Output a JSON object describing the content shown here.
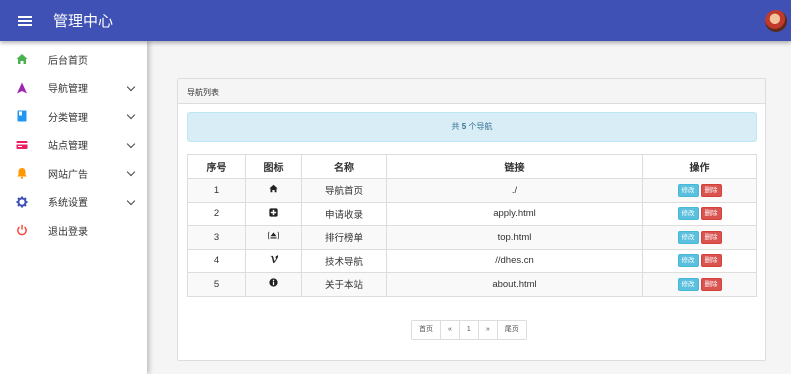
{
  "header": {
    "title": "管理中心"
  },
  "sidebar": {
    "items": [
      {
        "label": "后台首页",
        "icon": "home-icon",
        "color": "#4caf50",
        "expandable": false
      },
      {
        "label": "导航管理",
        "icon": "navigation-arrow-icon",
        "color": "#9c27b0",
        "expandable": true
      },
      {
        "label": "分类管理",
        "icon": "book-icon",
        "color": "#2196f3",
        "expandable": true
      },
      {
        "label": "站点管理",
        "icon": "card-icon",
        "color": "#e91e63",
        "expandable": true
      },
      {
        "label": "网站广告",
        "icon": "bell-icon",
        "color": "#ff9800",
        "expandable": true
      },
      {
        "label": "系统设置",
        "icon": "gear-icon",
        "color": "#3f51b5",
        "expandable": true
      },
      {
        "label": "退出登录",
        "icon": "power-icon",
        "color": "#f44336",
        "expandable": false
      }
    ]
  },
  "panel": {
    "title": "导航列表",
    "summary_prefix": "共",
    "summary_count": "5",
    "summary_suffix": "个导航"
  },
  "table": {
    "headers": [
      "序号",
      "图标",
      "名称",
      "链接",
      "操作"
    ],
    "rows": [
      {
        "id": "1",
        "icon": "home-icon",
        "name": "导航首页",
        "link": "./"
      },
      {
        "id": "2",
        "icon": "plus-square-icon",
        "name": "申请收录",
        "link": "apply.html"
      },
      {
        "id": "3",
        "icon": "eject-icon",
        "name": "排行榜单",
        "link": "top.html"
      },
      {
        "id": "4",
        "icon": "vimeo-icon",
        "name": "技术导航",
        "link": "//dhes.cn"
      },
      {
        "id": "5",
        "icon": "info-circle-icon",
        "name": "关于本站",
        "link": "about.html"
      }
    ],
    "edit_label": "修改",
    "delete_label": "删除"
  },
  "pagination": {
    "first": "首页",
    "prev": "«",
    "page": "1",
    "next": "»",
    "last": "尾页"
  }
}
